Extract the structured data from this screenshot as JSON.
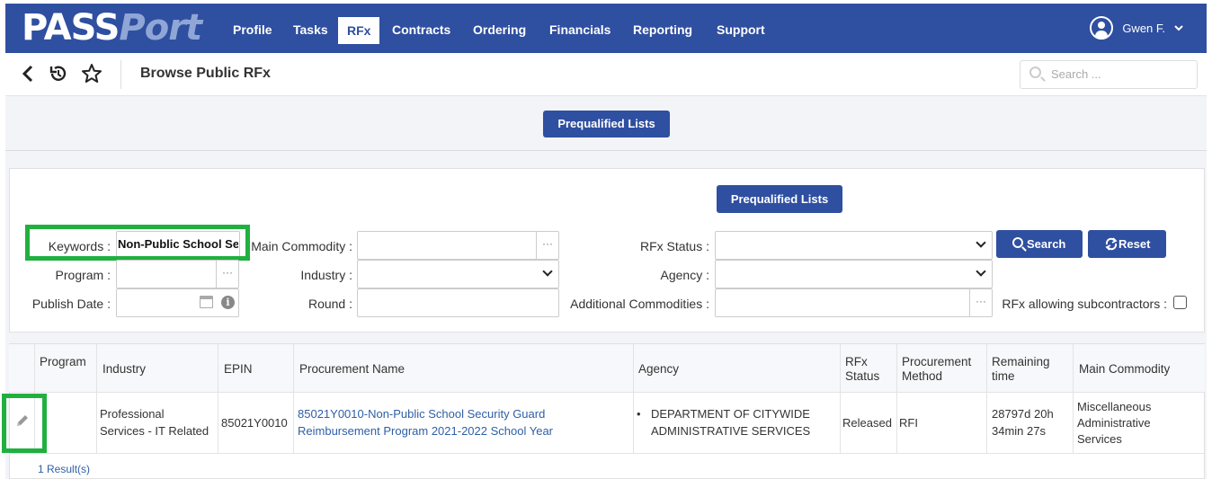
{
  "app": {
    "logo_pass": "PASS",
    "logo_port": "Port"
  },
  "nav": {
    "items": [
      "Profile",
      "Tasks",
      "RFx",
      "Contracts",
      "Ordering",
      "Financials",
      "Reporting",
      "Support"
    ],
    "active": "RFx",
    "user": "Gwen F."
  },
  "subbar": {
    "back_icon": "chevron-left-icon",
    "history_icon": "history-icon",
    "favorite_icon": "star-icon",
    "title": "Browse Public RFx",
    "search_placeholder": "Search ..."
  },
  "band": {
    "prequalified_label": "Prequalified Lists"
  },
  "filters": {
    "prequalified_label": "Prequalified Lists",
    "keywords_label": "Keywords :",
    "keywords_value": "Non-Public School Se",
    "main_commodity_label": "Main Commodity :",
    "rfx_status_label": "RFx Status :",
    "program_label": "Program :",
    "industry_label": "Industry :",
    "agency_label": "Agency :",
    "publish_date_label": "Publish Date :",
    "round_label": "Round :",
    "additional_commodities_label": "Additional Commodities :",
    "subcontractors_label": "RFx allowing subcontractors :",
    "ellipsis": "···",
    "search_label": "Search",
    "reset_label": "Reset",
    "info_glyph": "i"
  },
  "table": {
    "headers": {
      "program": "Program",
      "industry": "Industry",
      "epin": "EPIN",
      "procurement_name": "Procurement Name",
      "agency": "Agency",
      "rfx_status_1": "RFx",
      "rfx_status_2": "Status",
      "method_1": "Procurement",
      "method_2": "Method",
      "remaining_1": "Remaining",
      "remaining_2": "time",
      "main_commodity": "Main Commodity"
    },
    "row": {
      "program": "",
      "industry_1": "Professional",
      "industry_2": "Services - IT Related",
      "epin": "85021Y0010",
      "name_1": "85021Y0010-Non-Public School Security Guard",
      "name_2": "Reimbursement Program 2021-2022 School Year",
      "agency_bullet": "•",
      "agency_1": "DEPARTMENT OF CITYWIDE",
      "agency_2": "ADMINISTRATIVE SERVICES",
      "status": "Released",
      "method": "RFI",
      "remaining_1": "28797d 20h",
      "remaining_2": "34min 27s",
      "commodity_1": "Miscellaneous",
      "commodity_2": "Administrative",
      "commodity_3": "Services"
    },
    "result_count": "1 Result(s)"
  },
  "colors": {
    "brand": "#2f4fa0",
    "highlight": "#20b040",
    "link": "#2f5fa6"
  }
}
